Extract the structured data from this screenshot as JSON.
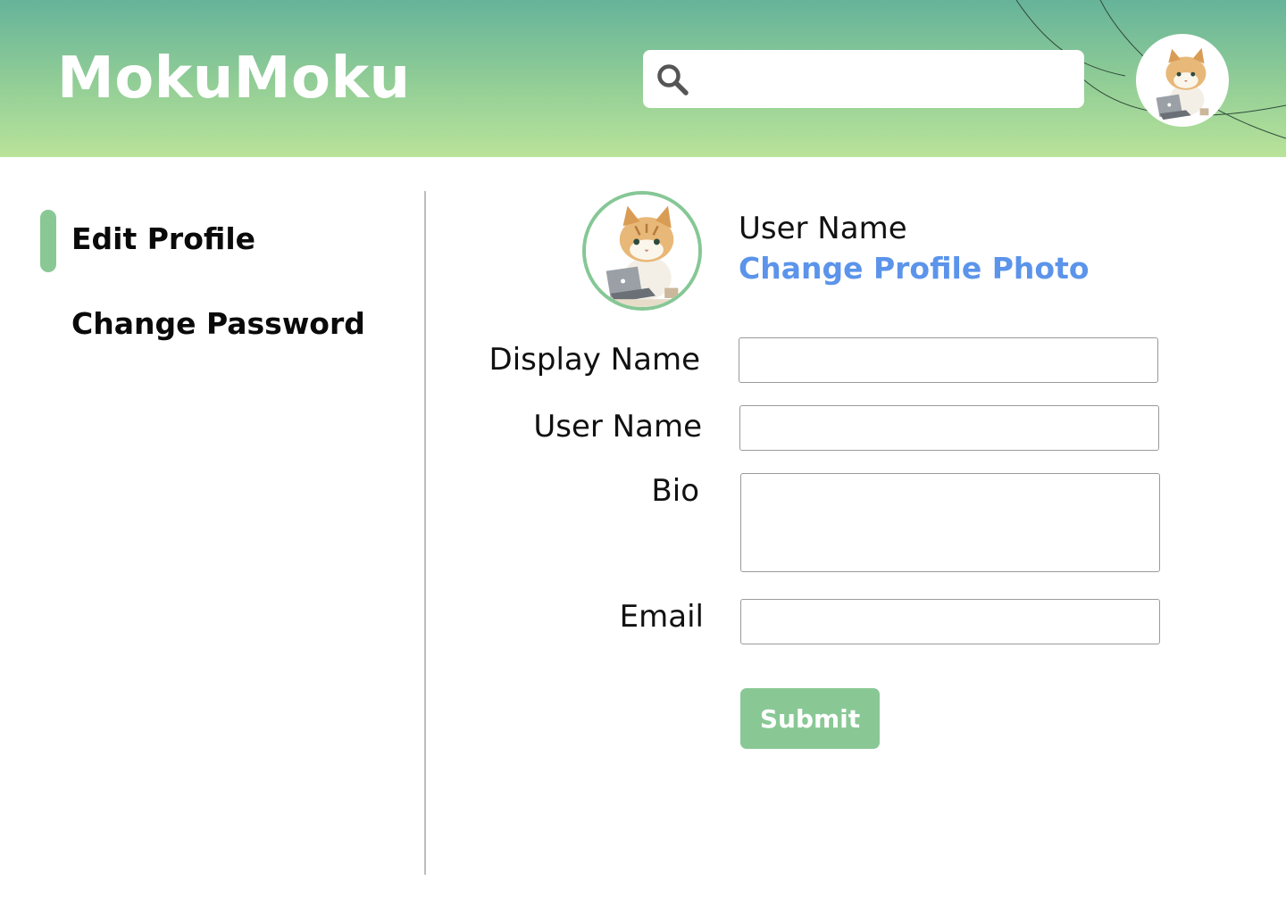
{
  "app": {
    "title": "MokuMoku"
  },
  "search": {
    "placeholder": "",
    "value": "",
    "icon": "search-icon"
  },
  "user": {
    "avatar_icon": "cat-avatar-icon"
  },
  "sidebar": {
    "items": [
      {
        "label": "Edit Profile",
        "active": true
      },
      {
        "label": "Change Password",
        "active": false
      }
    ]
  },
  "profile": {
    "username": "User Name",
    "change_photo_label": "Change Profile Photo"
  },
  "form": {
    "display_name": {
      "label": "Display Name",
      "value": ""
    },
    "user_name": {
      "label": "User Name",
      "value": ""
    },
    "bio": {
      "label": "Bio",
      "value": ""
    },
    "email": {
      "label": "Email",
      "value": ""
    },
    "submit_label": "Submit"
  },
  "colors": {
    "header_top": "#66b39a",
    "header_bottom": "#b9e39a",
    "accent_green": "#89c895",
    "link_blue": "#5b94ea"
  }
}
